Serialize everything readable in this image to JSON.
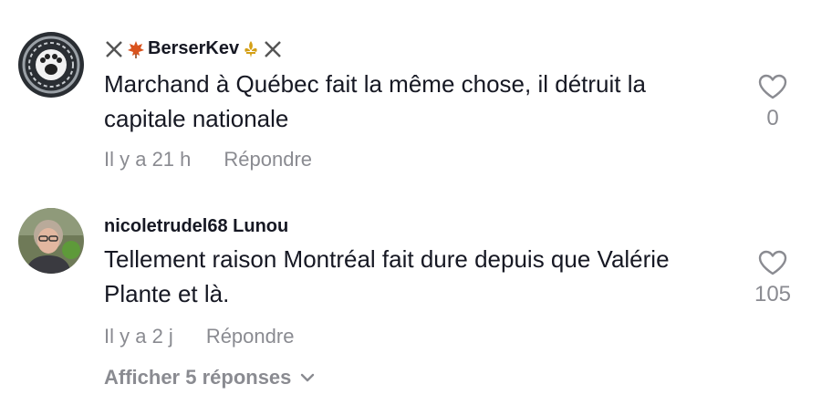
{
  "comments": [
    {
      "username": "BerserKev",
      "text": "Marchand à Québec fait la même chose, il détruit la capitale nationale",
      "time": "Il y a 21 h",
      "reply_label": "Répondre",
      "likes": "0"
    },
    {
      "username": "nicoletrudel68 Lunou",
      "text": "Tellement raison Montréal fait dure depuis que Valérie Plante et là.",
      "time": "Il y a 2 j",
      "reply_label": "Répondre",
      "likes": "105",
      "view_replies_label": "Afficher 5 réponses"
    }
  ],
  "icons": {
    "like": "heart-outline-icon",
    "expand": "chevron-down-icon"
  },
  "colors": {
    "text": "#161823",
    "secondary": "#8a8b91"
  }
}
